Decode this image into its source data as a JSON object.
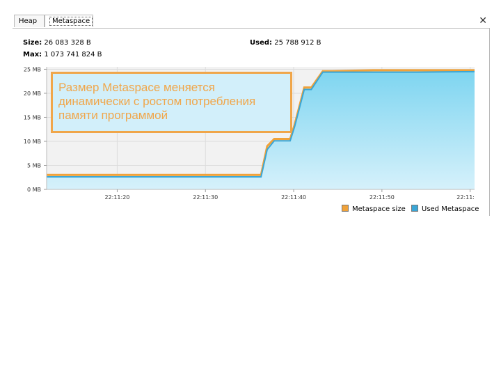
{
  "tabs": [
    {
      "label": "Heap"
    },
    {
      "label": "Metaspace"
    }
  ],
  "close_glyph": "✕",
  "stats": {
    "size_label": "Size:",
    "size_value": "26 083 328 B",
    "max_label": "Max:",
    "max_value": "1 073 741 824 B",
    "used_label": "Used:",
    "used_value": "25 788 912 B"
  },
  "callout": "Размер Metaspace меняется динамически с ростом потребления памяти программой",
  "legend": [
    {
      "label": "Metaspace size",
      "color": "#f0a23a"
    },
    {
      "label": "Used Metaspace",
      "color": "#3aa6d6"
    }
  ],
  "chart_data": {
    "type": "area",
    "ylim": [
      0,
      25.5
    ],
    "xlim_seconds": [
      0,
      48.5
    ],
    "yticks": [
      "0 MB",
      "5 MB",
      "10 MB",
      "15 MB",
      "20 MB",
      "25 MB"
    ],
    "ytick_values": [
      0,
      5,
      10,
      15,
      20,
      25
    ],
    "xticks": [
      "22:11:20",
      "22:11:30",
      "22:11:40",
      "22:11:50",
      "22:11:"
    ],
    "xtick_values": [
      8,
      18,
      28,
      38,
      48
    ],
    "grid": true,
    "series": [
      {
        "name": "Metaspace size",
        "x": [
          0,
          24.3,
          25,
          25.8,
          27.6,
          28.1,
          29.2,
          30,
          31.3,
          32.4,
          37,
          48.5
        ],
        "y": [
          3.0,
          3.0,
          9.0,
          10.5,
          10.5,
          13.4,
          21.2,
          21.2,
          24.6,
          24.6,
          24.8,
          24.8
        ]
      },
      {
        "name": "Used Metaspace",
        "x": [
          0,
          24.3,
          25,
          25.8,
          27.6,
          28.1,
          29.2,
          30,
          31.3,
          32.4,
          42,
          48.5
        ],
        "y": [
          2.6,
          2.6,
          8.3,
          10.1,
          10.1,
          13.0,
          20.8,
          20.8,
          24.4,
          24.4,
          24.4,
          24.5
        ]
      }
    ]
  }
}
